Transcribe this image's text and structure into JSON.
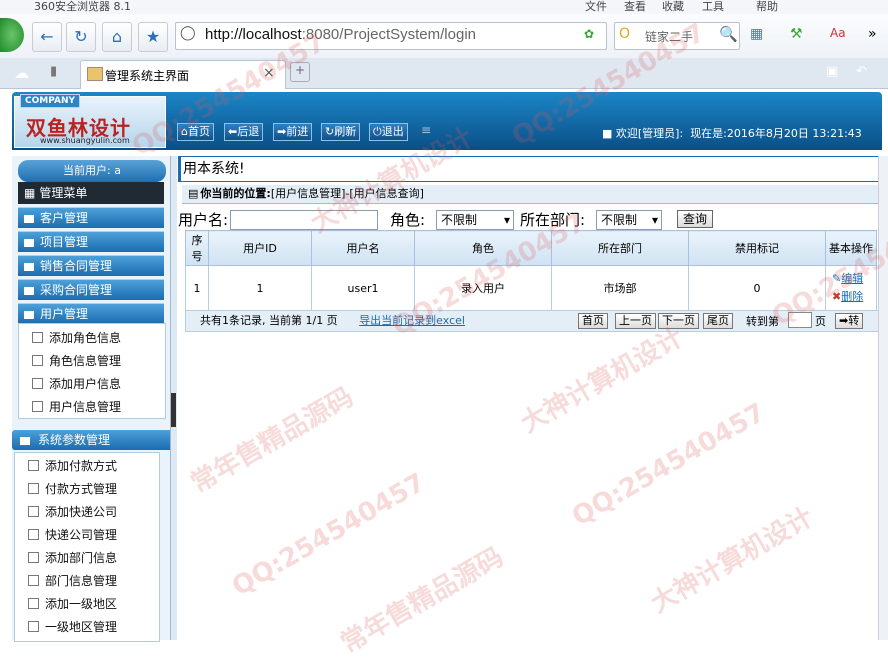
{
  "browser": {
    "title": "360安全浏览器 8.1",
    "menu": [
      "文件",
      "查看",
      "收藏",
      "工具",
      "帮助"
    ],
    "url_host": "http://localhost",
    "url_path": ":8080/ProjectSystem/login",
    "search_placeholder": "链家二手",
    "tab_title": "管理系统主界面"
  },
  "header": {
    "company_tag": "COMPANY",
    "logo_text": "双鱼林设计",
    "logo_url": "www.shuangyulin.com",
    "nav": [
      "首页",
      "后退",
      "前进",
      "刷新",
      "退出"
    ],
    "welcome": "欢迎[管理员]:",
    "now_label": "现在是:",
    "datetime": "2016年8月20日 13:21:43"
  },
  "sidebar": {
    "current_user": "当前用户: a",
    "menu_title": "管理菜单",
    "groups": [
      "客户管理",
      "项目管理",
      "销售合同管理",
      "采购合同管理",
      "用户管理"
    ],
    "user_items": [
      "添加角色信息",
      "角色信息管理",
      "添加用户信息",
      "用户信息管理"
    ],
    "sys_group": "系统参数管理",
    "sys_items": [
      "添加付款方式",
      "付款方式管理",
      "添加快递公司",
      "快递公司管理",
      "添加部门信息",
      "部门信息管理",
      "添加一级地区",
      "一级地区管理"
    ]
  },
  "main": {
    "notice": "用本系统!",
    "location_label": "你当前的位置:",
    "location_path": "[用户信息管理]-[用户信息查询]",
    "filter_username_label": "用户名:",
    "filter_role_label": "角色:",
    "role_value": "不限制",
    "filter_dept_label": "所在部门:",
    "dept_value": "不限制",
    "query_label": "查询"
  },
  "table": {
    "headers": [
      "序号",
      "用户ID",
      "用户名",
      "角色",
      "所在部门",
      "禁用标记",
      "基本操作"
    ],
    "rows": [
      [
        "1",
        "1",
        "user1",
        "录入用户",
        "市场部",
        "0"
      ]
    ],
    "edit_label": "编辑",
    "delete_label": "删除"
  },
  "pager": {
    "summary": "共有1条记录, 当前第 1/1 页",
    "export_label": "导出当前记录到excel",
    "first": "首页",
    "prev": "上一页",
    "next": "下一页",
    "last": "尾页",
    "goto_label": "转到第",
    "page_unit": "页",
    "go": "转"
  },
  "watermark": [
    "QQ:254540457",
    "大神计算机设计",
    "常年售精品源码"
  ]
}
